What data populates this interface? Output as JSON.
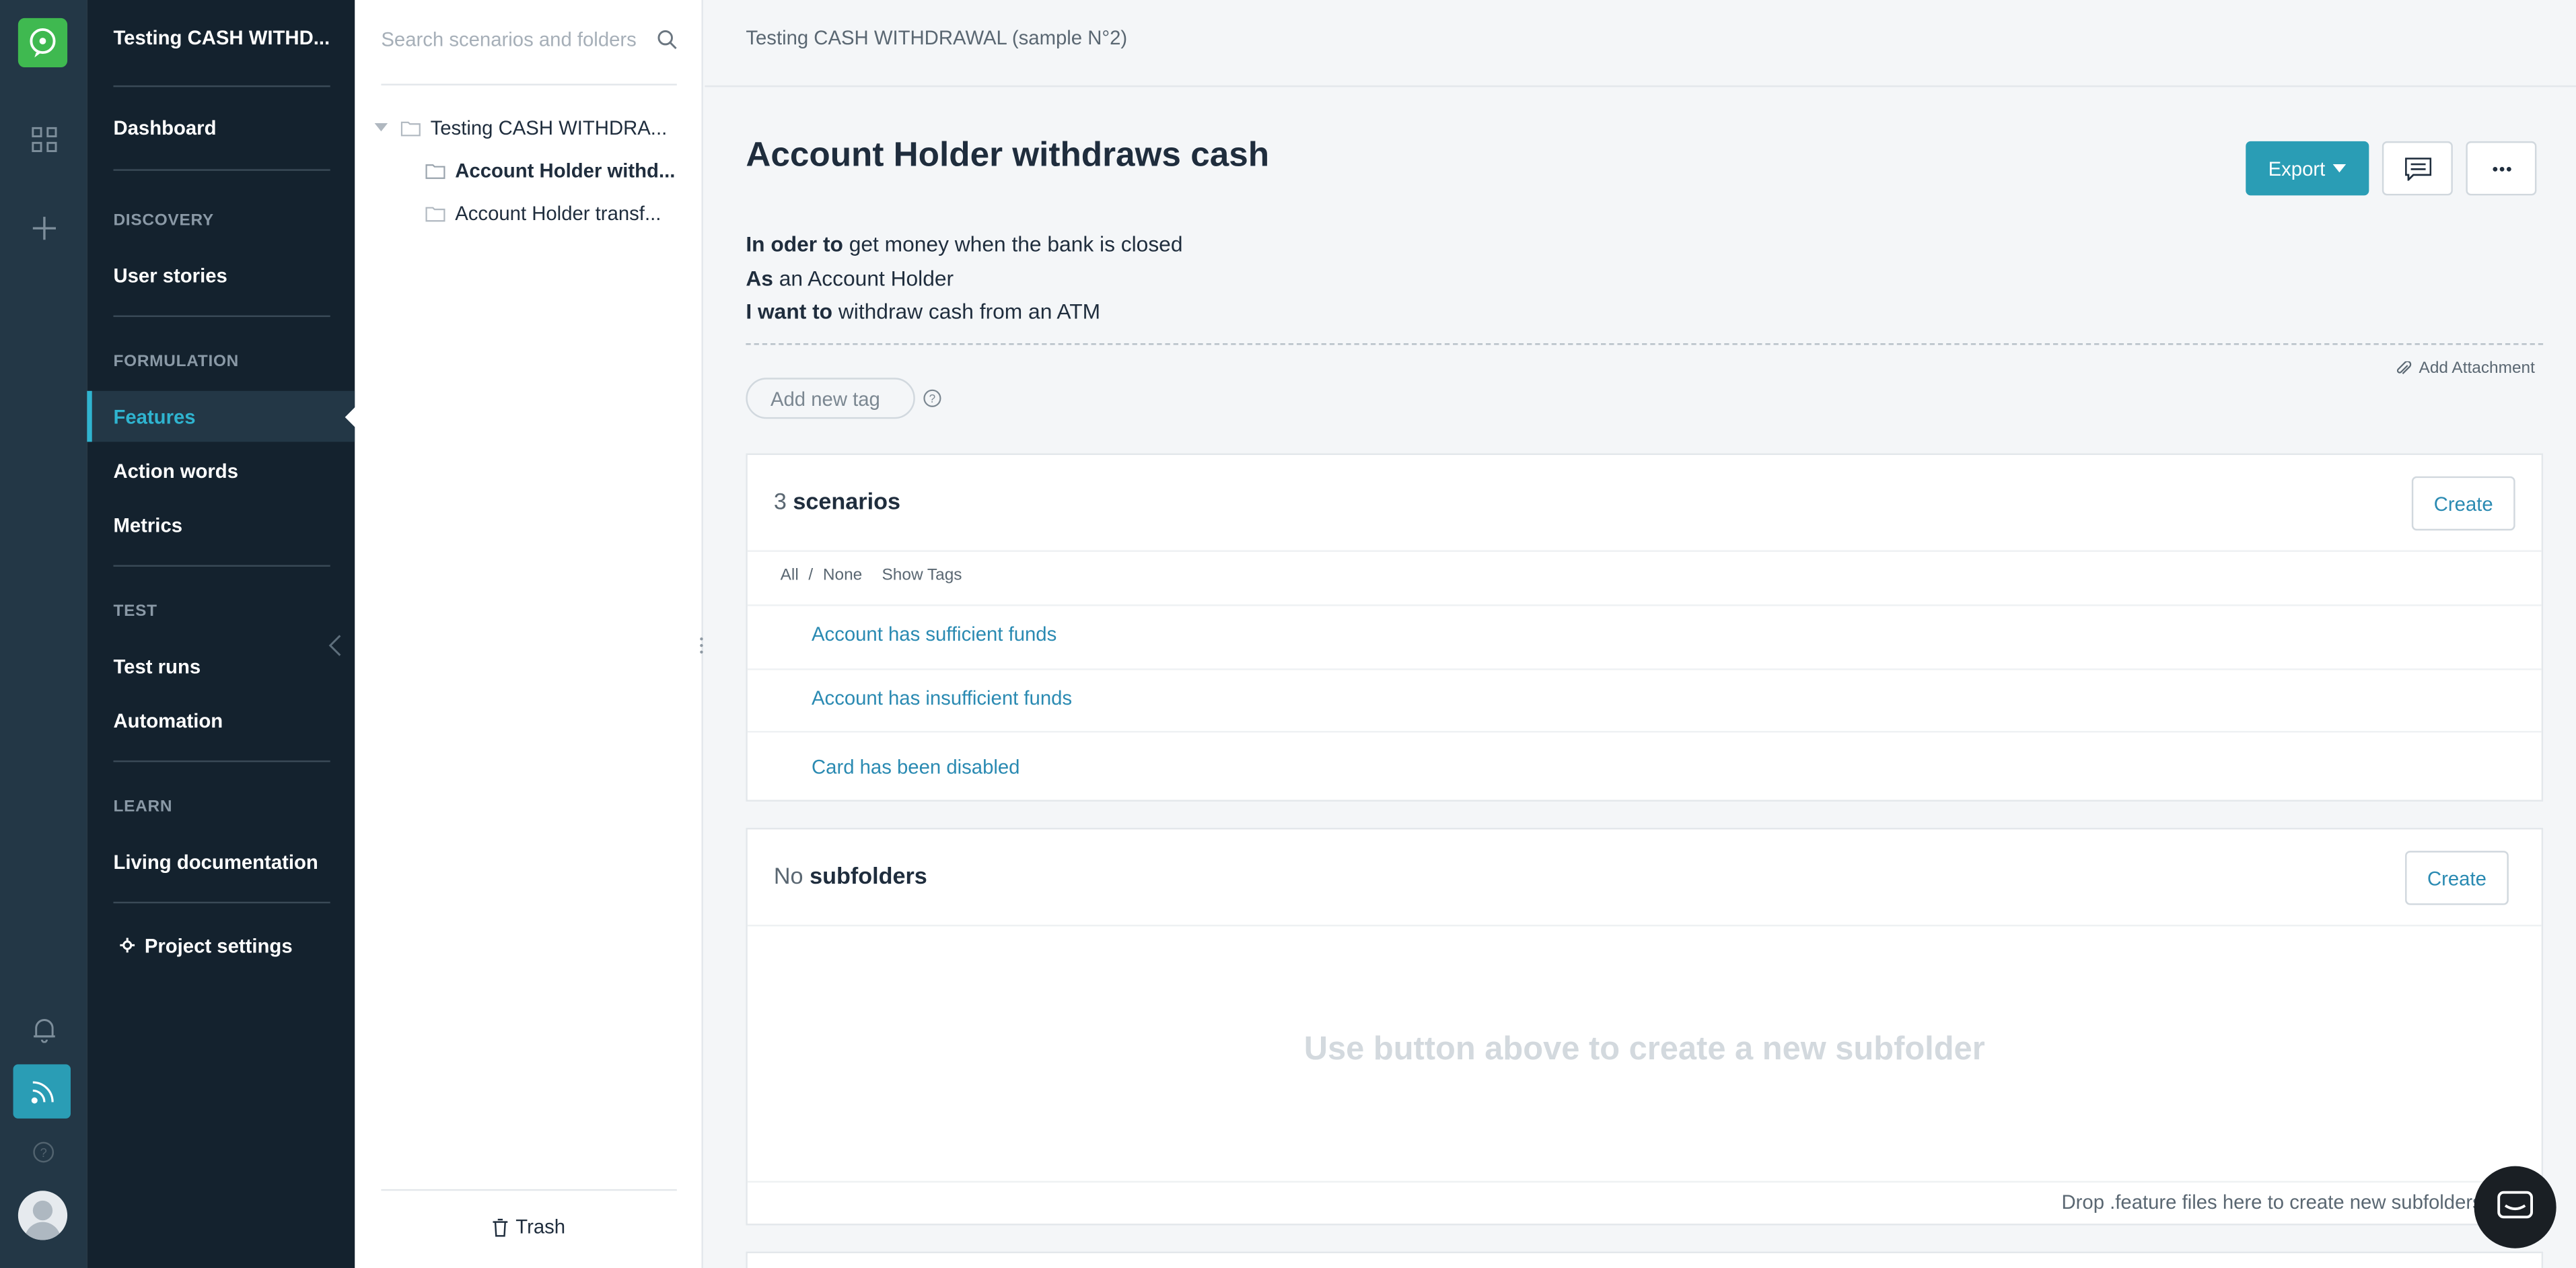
{
  "rail": {
    "icons": [
      "logo-icon",
      "grid-icon",
      "plus-icon",
      "bell-icon",
      "feed-icon",
      "help-icon",
      "avatar-icon"
    ]
  },
  "nav": {
    "project_title": "Testing CASH WITHD...",
    "dashboard": "Dashboard",
    "discovery_section": "DISCOVERY",
    "user_stories": "User stories",
    "formulation_section": "FORMULATION",
    "features": "Features",
    "action_words": "Action words",
    "metrics": "Metrics",
    "test_section": "TEST",
    "test_runs": "Test runs",
    "automation": "Automation",
    "learn_section": "LEARN",
    "living_documentation": "Living documentation",
    "project_settings": "Project settings",
    "active_color": "#2fb4d0"
  },
  "tree": {
    "search_placeholder": "Search scenarios and folders",
    "root_folder": "Testing CASH WITHDRA...",
    "child_1": "Account Holder withd...",
    "child_2": "Account Holder transf...",
    "trash": "Trash"
  },
  "main": {
    "breadcrumb": "Testing CASH WITHDRAWAL (sample N°2)",
    "title": "Account Holder withdraws cash",
    "export_label": "Export",
    "story": [
      {
        "keyword": "In oder to",
        "text": " get money when the bank is closed"
      },
      {
        "keyword": "As",
        "text": " an Account Holder"
      },
      {
        "keyword": "I want to",
        "text": " withdraw cash from an ATM"
      }
    ],
    "add_attachment": "Add Attachment",
    "tag_placeholder": "Add new tag",
    "scenarios": {
      "count": "3",
      "word": "scenarios",
      "create_label": "Create",
      "filter_all": "All",
      "filter_sep": "/",
      "filter_none": "None",
      "show_tags": "Show Tags",
      "items": [
        "Account has sufficient funds",
        "Account has insufficient funds",
        "Card has been disabled"
      ]
    },
    "subfolders": {
      "count": "No",
      "word": "subfolders",
      "create_label": "Create",
      "empty_message": "Use button above to create a new subfolder",
      "drop_message": "Drop .feature files here to create new subfolders"
    },
    "accent_color": "#2a9db5"
  }
}
